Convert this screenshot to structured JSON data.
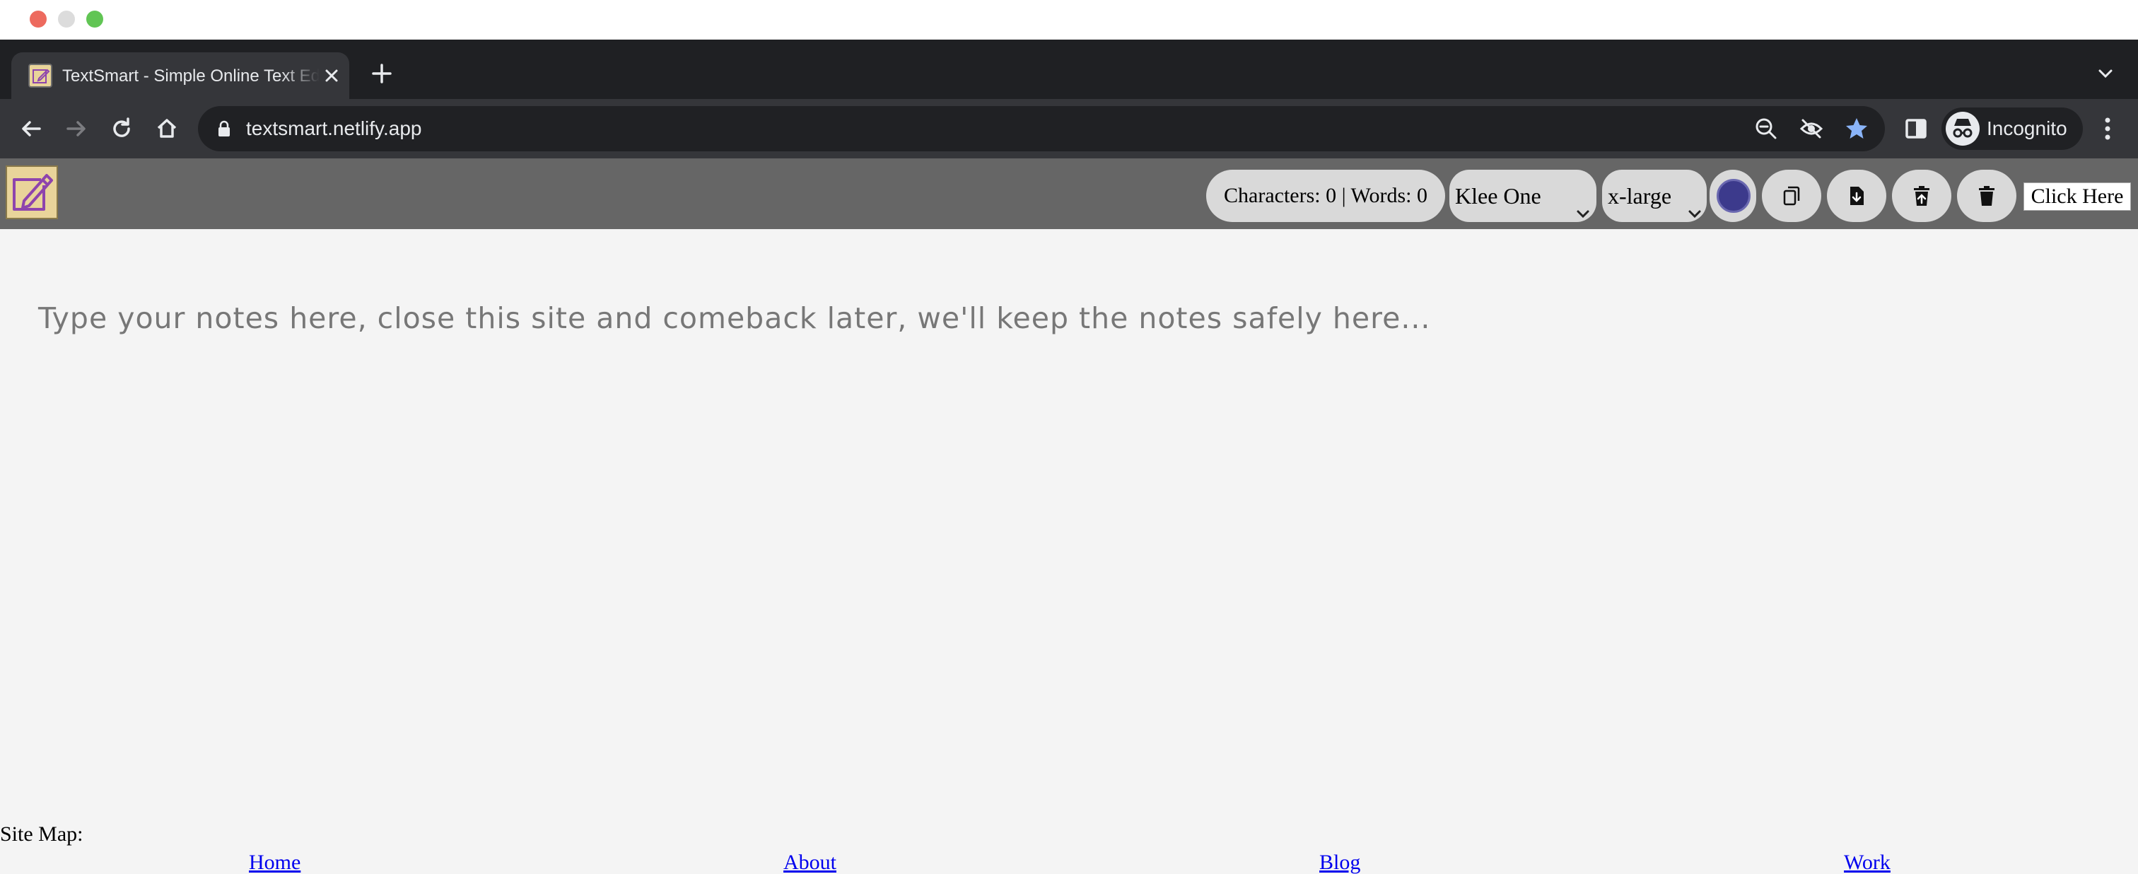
{
  "browser": {
    "tab": {
      "title": "TextSmart - Simple Online Text Editor"
    },
    "omnibox": {
      "url": "textsmart.netlify.app"
    },
    "profile": {
      "label": "Incognito"
    }
  },
  "app": {
    "counter_text": "Characters: 0 | Words: 0",
    "font_select": {
      "selected": "Klee One"
    },
    "size_select": {
      "selected": "x-large"
    },
    "text_color": "#3c3a8c",
    "click_button": "Click Here",
    "editor": {
      "placeholder": "Type your notes here, close this site and comeback later, we'll keep the notes safely here..."
    }
  },
  "footer": {
    "sitemap_label": "Site Map:",
    "links": [
      {
        "label": "Home"
      },
      {
        "label": "About"
      },
      {
        "label": "Blog"
      },
      {
        "label": "Work"
      }
    ]
  }
}
